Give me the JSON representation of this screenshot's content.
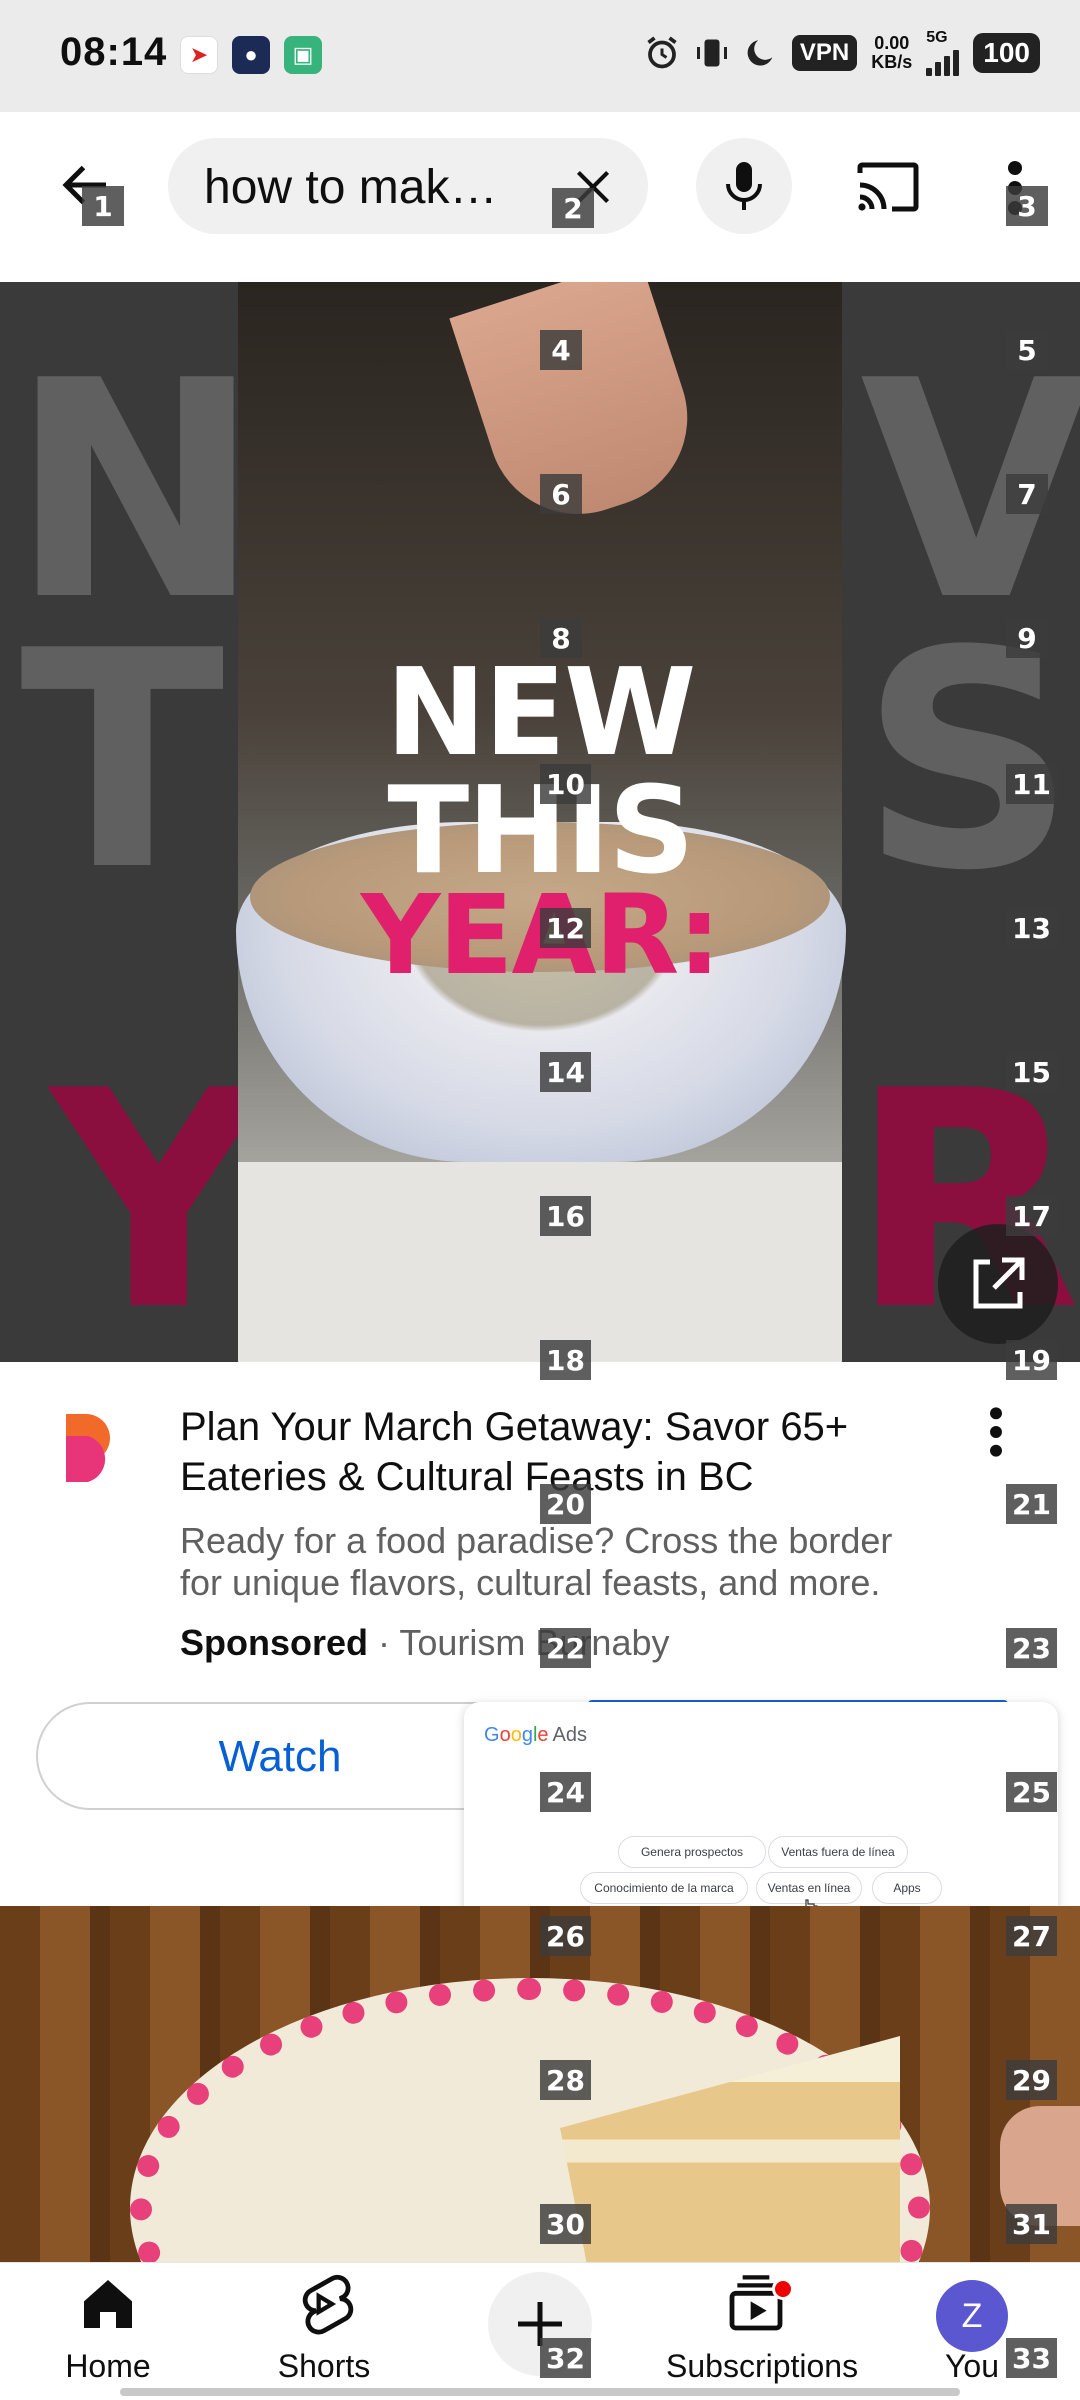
{
  "status_bar": {
    "time": "08:14",
    "vpn": "VPN",
    "net_speed": "0.00",
    "net_unit": "KB/s",
    "network": "5G",
    "battery": "100"
  },
  "search": {
    "query": "how to mak…"
  },
  "video_ad": {
    "line1": "NEW",
    "line2": "THIS",
    "line3": "YEAR:",
    "bg_left": [
      "N",
      "T",
      "Y"
    ],
    "bg_right": [
      "V",
      "S",
      "R:"
    ]
  },
  "ad_card": {
    "headline": "Plan Your March Getaway: Savor 65+ Eateries & Cultural Feasts in BC",
    "description": "Ready for a food paradise? Cross the border for unique flavors, cultural feasts, and more.",
    "sponsored": "Sponsored",
    "separator": "·",
    "advertiser": "Tourism Burnaby",
    "watch": "Watch"
  },
  "google_ads": {
    "logo_g": "G",
    "logo_o1": "o",
    "logo_o2": "o",
    "logo_g2": "g",
    "logo_l": "l",
    "logo_e": "e",
    "logo_ads": "Ads",
    "chips": [
      "Genera prospectos",
      "Ventas fuera de línea",
      "Conocimiento de la marca",
      "Ventas en línea",
      "Apps"
    ]
  },
  "nav": {
    "home": "Home",
    "shorts": "Shorts",
    "subscriptions": "Subscriptions",
    "you": "You",
    "avatar_letter": "Z"
  },
  "markers": [
    "1",
    "2",
    "3",
    "4",
    "5",
    "6",
    "7",
    "8",
    "9",
    "10",
    "11",
    "12",
    "13",
    "14",
    "15",
    "16",
    "17",
    "18",
    "19",
    "20",
    "21",
    "22",
    "23",
    "24",
    "25",
    "26",
    "27",
    "28",
    "29",
    "30",
    "31",
    "32",
    "33"
  ],
  "colors": {
    "accent_pink": "#e0206c",
    "link_blue": "#065fd4",
    "avatar": "#5b57d1"
  }
}
